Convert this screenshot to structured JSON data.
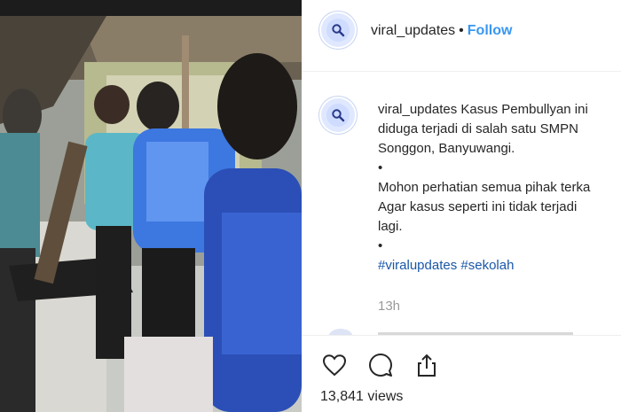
{
  "post": {
    "username": "viral_updates",
    "separator": "•",
    "follow_label": "Follow",
    "caption_user": "viral_updates",
    "caption_lines": [
      "Kasus Pembullyan ini",
      "diduga terjadi di salah satu SMPN",
      "Songgon, Banyuwangi.",
      "•",
      "Mohon perhatian semua pihak terka",
      "Agar kasus seperti ini tidak terjadi",
      "lagi.",
      "•"
    ],
    "hashtags": [
      "#viralupdates",
      "#sekolah"
    ],
    "time_ago": "13h",
    "views": "13,841 views"
  },
  "icons": {
    "avatar": "magnifier-icon",
    "like": "heart-icon",
    "comment": "comment-bubble-icon",
    "share": "share-icon"
  },
  "colors": {
    "follow": "#3897f0",
    "hashtag": "#1a57a8",
    "text": "#262626",
    "muted": "#9a9a9a"
  }
}
